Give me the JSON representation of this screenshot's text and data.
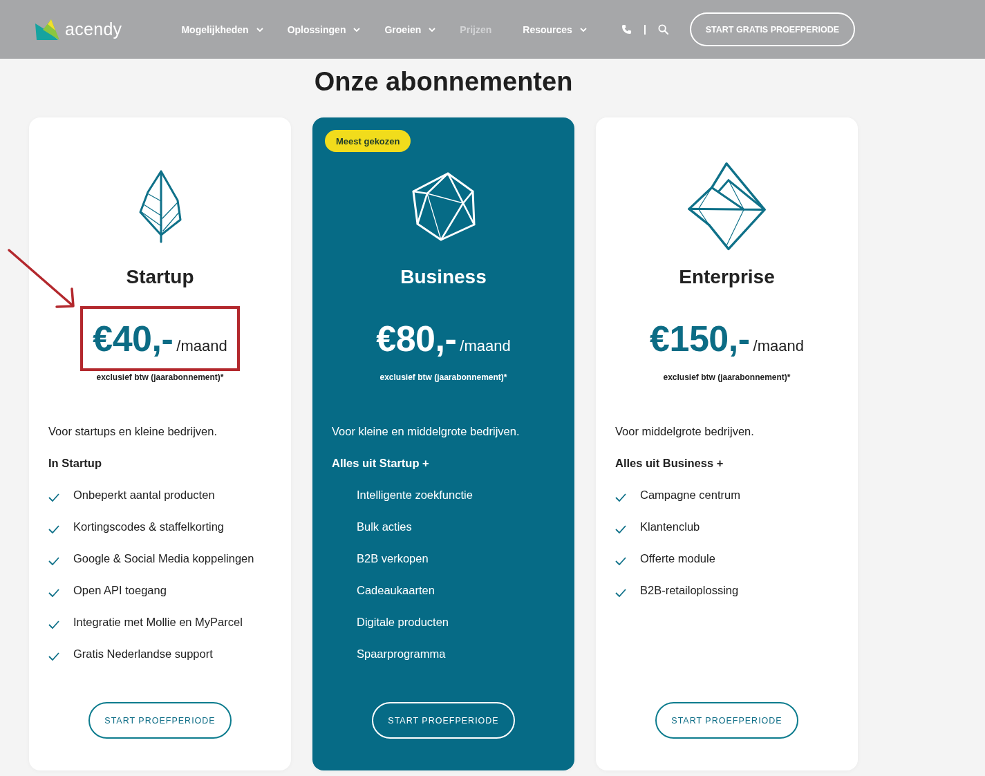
{
  "header": {
    "logo": "acendy",
    "nav": [
      {
        "label": "Mogelijkheden",
        "dropdown": true,
        "selected": false
      },
      {
        "label": "Oplossingen",
        "dropdown": true,
        "selected": false
      },
      {
        "label": "Groeien",
        "dropdown": true,
        "selected": false
      },
      {
        "label": "Prijzen",
        "dropdown": false,
        "selected": true
      },
      {
        "label": "Resources",
        "dropdown": true,
        "selected": false
      }
    ],
    "cta": "START GRATIS PROEFPERIODE"
  },
  "title": "Onze abonnementen",
  "plans": [
    {
      "name": "Startup",
      "kind": "leaf",
      "featured": false,
      "highlighted": true,
      "price": "€40,-",
      "period": "/maand",
      "note": "exclusief btw (jaarabonnement)*",
      "description": "Voor startups en kleine bedrijven.",
      "features_heading": "In Startup",
      "ticks": true,
      "features": [
        "Onbeperkt aantal producten",
        "Kortingscodes & staffelkorting",
        "Google & Social Media koppelingen",
        "Open API toegang",
        "Integratie met Mollie en MyParcel",
        "Gratis Nederlandse support"
      ],
      "button": "START PROEFPERIODE"
    },
    {
      "name": "Business",
      "kind": "polyhedron",
      "featured": true,
      "badge": "Meest gekozen",
      "price": "€80,-",
      "period": "/maand",
      "note": "exclusief btw (jaarabonnement)*",
      "description": "Voor kleine en middelgrote bedrijven.",
      "features_heading": "Alles uit Startup +",
      "ticks": false,
      "features": [
        "Intelligente zoekfunctie",
        "Bulk acties",
        "B2B verkopen",
        "Cadeaukaarten",
        "Digitale producten",
        "Spaarprogramma"
      ],
      "button": "START PROEFPERIODE"
    },
    {
      "name": "Enterprise",
      "kind": "diamond",
      "featured": false,
      "price": "€150,-",
      "period": "/maand",
      "note": "exclusief btw (jaarabonnement)*",
      "description": "Voor middelgrote bedrijven.",
      "features_heading": "Alles uit Business +",
      "ticks": true,
      "features": [
        "Campagne centrum",
        "Klantenclub",
        "Offerte module",
        "B2B-retailoplossing"
      ],
      "button": "START PROEFPERIODE"
    }
  ]
}
